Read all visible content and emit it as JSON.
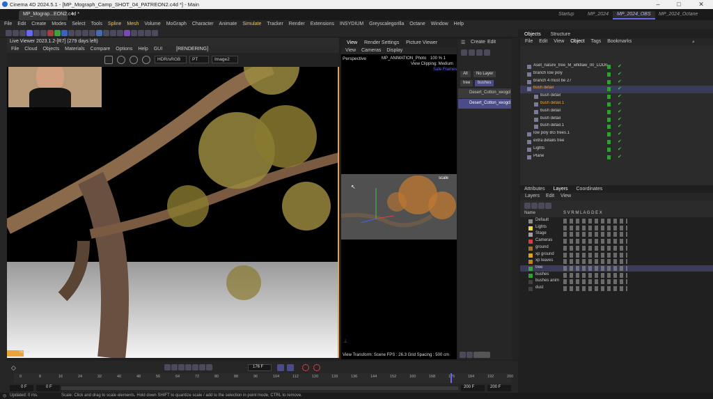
{
  "window": {
    "title": "Cinema 4D 2024.5.1 - [MP_Mograph_Camp_SHOT_04_PATREON2.c4d *] - Main"
  },
  "tabs": {
    "file_tab": "MP_Mograp...EON2.c4d *",
    "add": "+"
  },
  "layouts": [
    "Startup",
    "MP_2024",
    "MP_2024_OBS",
    "MP_2024_Octane"
  ],
  "menu": [
    "File",
    "Edit",
    "Create",
    "Modes",
    "Select",
    "Tools",
    "Spline",
    "Mesh",
    "Volume",
    "MoGraph",
    "Character",
    "Animate",
    "Simulate",
    "Tracker",
    "Render",
    "Extensions",
    "INSYDIUM",
    "Greyscalegorilla",
    "Octane",
    "Window",
    "Help"
  ],
  "live_viewer": {
    "title": "Live Viewer 2023.1.2-[R7] (279 days left)",
    "menu": [
      "File",
      "Cloud",
      "Objects",
      "Materials",
      "Compare",
      "Options",
      "Help",
      "GUI"
    ],
    "status": "[RENDERING]",
    "color_space": "HDR/sRGB",
    "pt_mode": "PT",
    "image_slot": "Image2",
    "footer_badge": "Noise"
  },
  "viewport": {
    "tabs": [
      "View",
      "Render Settings",
      "Picture Viewer"
    ],
    "menu": [
      "View",
      "Cameras",
      "Display"
    ],
    "camera": "Perspective",
    "overlay_title": "MP_ANIMATION_Photo",
    "overlay_zoom": "100 % 1",
    "clipping": "View Clipping: Medium",
    "safe_frames": "Safe Frames",
    "scale_label": "scale",
    "footer": "View Transform: Scene  FPS : 26.3     Grid Spacing : 500 cm"
  },
  "layer_manager_mini": {
    "menu": [
      "Create",
      "Edit"
    ],
    "chips": [
      "All",
      "No Layer"
    ],
    "filters": [
      "tree",
      "bushes"
    ],
    "assets": [
      "Desert_Cotton_xeogcl",
      "Desert_Cotton_xeogcl"
    ]
  },
  "objects_panel": {
    "tabs": [
      "Objects",
      "Structure"
    ],
    "menu": [
      "File",
      "Edit",
      "View",
      "Object",
      "Tags",
      "Bookmarks"
    ],
    "rows": [
      {
        "name": "Aset_nature_tree_M_wfktlaw_00_LOD0",
        "indent": 0
      },
      {
        "name": "branch low poly",
        "indent": 0
      },
      {
        "name": "branch 4 must be 27",
        "indent": 0
      },
      {
        "name": "bush detail",
        "indent": 0
      },
      {
        "name": "bush detail",
        "indent": 1
      },
      {
        "name": "bush detail.1",
        "indent": 1
      },
      {
        "name": "bush detail",
        "indent": 1
      },
      {
        "name": "bush detail",
        "indent": 1
      },
      {
        "name": "bush detail.1",
        "indent": 1
      },
      {
        "name": "low poly BG trees.1",
        "indent": 0
      },
      {
        "name": "extra details tree",
        "indent": 0
      },
      {
        "name": "Lights",
        "indent": 0
      },
      {
        "name": "Plane",
        "indent": 0
      }
    ]
  },
  "attr_panel": {
    "tabs": [
      "Attributes",
      "Layers",
      "Coordinates"
    ],
    "menu": [
      "Layers",
      "Edit",
      "View"
    ],
    "col_name": "Name",
    "col_flags": "S  V  R  M  L  A  G  D  E  X",
    "layers": [
      {
        "name": "Default",
        "color": "#8a8a8a"
      },
      {
        "name": "Lights",
        "color": "#e8d84a"
      },
      {
        "name": "Stage",
        "color": "#a0a0a0"
      },
      {
        "name": "Cameras",
        "color": "#d04040"
      },
      {
        "name": "ground",
        "color": "#a07030"
      },
      {
        "name": "xp ground",
        "color": "#e0a020"
      },
      {
        "name": "xp leaves",
        "color": "#c08020"
      },
      {
        "name": "tree",
        "color": "#40a040"
      },
      {
        "name": "bushes",
        "color": "#30a030"
      },
      {
        "name": "bushes anim",
        "color": "#404040"
      },
      {
        "name": "dust",
        "color": "#404040"
      }
    ]
  },
  "timeline": {
    "ticks": [
      "0",
      "8",
      "16",
      "24",
      "32",
      "40",
      "48",
      "56",
      "64",
      "72",
      "80",
      "88",
      "96",
      "104",
      "112",
      "120",
      "128",
      "136",
      "144",
      "152",
      "160",
      "168",
      "176",
      "184",
      "192",
      "200"
    ],
    "current_frame": "176 F",
    "start_a": "0 F",
    "start_b": "0 F",
    "end_a": "200 F",
    "end_b": "200 F"
  },
  "statusbar": {
    "left": "Updated: 0 ms.",
    "hint": "Scale: Click and drag to scale elements. Hold down SHIFT to quantize scale / add to the selection in point mode, CTRL to remove."
  },
  "colors": {
    "accent": "#6a6af0",
    "highlight": "#e9c46a",
    "selection": "#3a3a5a"
  }
}
